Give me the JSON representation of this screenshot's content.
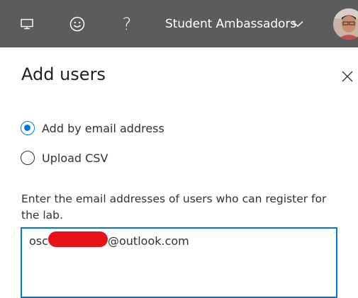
{
  "topbar": {
    "account_name": "Student Ambassadors",
    "help_symbol": "?",
    "icons": {
      "monitor": "monitor-icon",
      "smile": "smile-icon",
      "help": "help-icon",
      "chevron": "chevron-down-icon"
    },
    "background_color": "#5c5c5c"
  },
  "panel": {
    "title": "Add users",
    "options": [
      {
        "label": "Add by email address",
        "selected": true
      },
      {
        "label": "Upload CSV",
        "selected": false
      }
    ],
    "email_field": {
      "label": "Enter the email addresses of users who can register for the lab.",
      "value_prefix": "osc",
      "value_suffix": "@outlook.com"
    },
    "accent_color": "#0078d4",
    "redaction_color": "#e8111a"
  }
}
